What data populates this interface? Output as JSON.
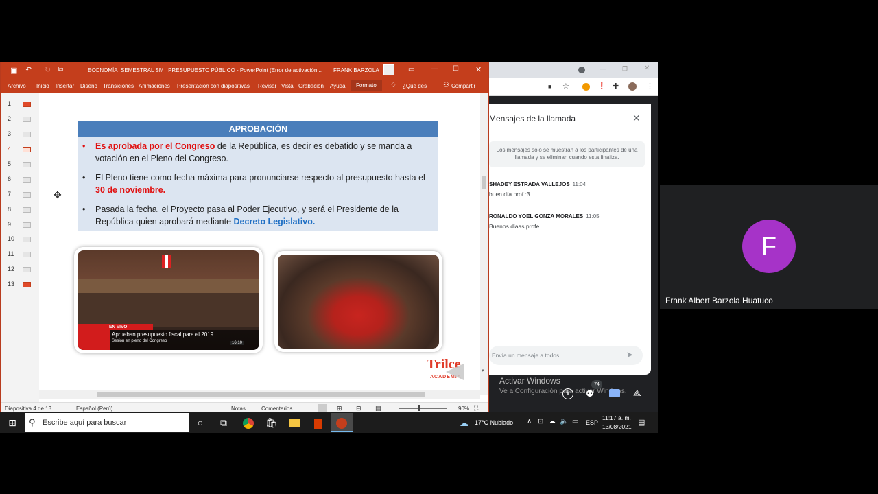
{
  "ppt": {
    "doc_title": "ECONOMÍA_SEMESTRAL SM_ PRESUPUESTO PÚBLICO  -  PowerPoint (Error de activación...",
    "user": "FRANK BARZOLA",
    "tabs": [
      "Archivo",
      "Inicio",
      "Insertar",
      "Diseño",
      "Transiciones",
      "Animaciones",
      "Presentación con diapositivas",
      "Revisar",
      "Vista",
      "Grabación",
      "Ayuda",
      "Formato"
    ],
    "tell_me": "¿Qué des",
    "share": "Compartir",
    "thumb_numbers": [
      "1",
      "2",
      "3",
      "4",
      "5",
      "6",
      "7",
      "8",
      "9",
      "10",
      "11",
      "12",
      "13"
    ],
    "status": {
      "slide": "Diapositiva 4 de 13",
      "lang": "Español (Perú)",
      "notes": "Notas",
      "comments": "Comentarios",
      "zoom": "90%"
    }
  },
  "slide": {
    "header": "APROBACIÓN",
    "b1_dot": "•",
    "b1_red": "Es aprobada por el Congreso",
    "b1_rest": " de la República, es decir es debatido y se manda a votación en el Pleno del Congreso.",
    "b2_dot": "•",
    "b2_text": " El Pleno tiene como fecha máxima para pronunciarse respecto al presupuesto hasta el ",
    "b2_red": "30 de noviembre.",
    "b3_dot": "•",
    "b3_text": "Pasada la fecha, el Proyecto pasa al Poder Ejecutivo, y será el Presidente de la República quien aprobará mediante ",
    "b3_blue": "Decreto Legislativo.",
    "photo1_live": "EN VIVO",
    "photo1_caption": "Aprueban presupuesto fiscal para el 2019",
    "photo1_sub": "Sesión en pleno del Congreso",
    "photo1_time": "16:10",
    "logo": "Trilce",
    "logo_sub": "ACADEMIA"
  },
  "meet": {
    "chat_title": "Mensajes de la llamada",
    "note": "Los mensajes solo se muestran a los participantes de una llamada y se eliminan cuando esta finaliza.",
    "messages": [
      {
        "name": "SHADEY ESTRADA VALLEJOS",
        "time": "11:04",
        "text": "buen  día prof :3"
      },
      {
        "name": "RONALDO YOEL GONZA MORALES",
        "time": "11:05",
        "text": "Buenos diaas profe"
      }
    ],
    "input_placeholder": "Envía un mensaje a todos",
    "activar_title": "Activar Windows",
    "activar_sub": "Ve a Configuración para activar Windows.",
    "participants_badge": "74",
    "participant_initial": "F",
    "participant_name": "Frank Albert Barzola Huatuco"
  },
  "taskbar": {
    "search": "Escribe aquí para buscar",
    "weather": "17°C  Nublado",
    "lang": "ESP",
    "time": "11:17 a. m.",
    "date": "13/08/2021"
  }
}
